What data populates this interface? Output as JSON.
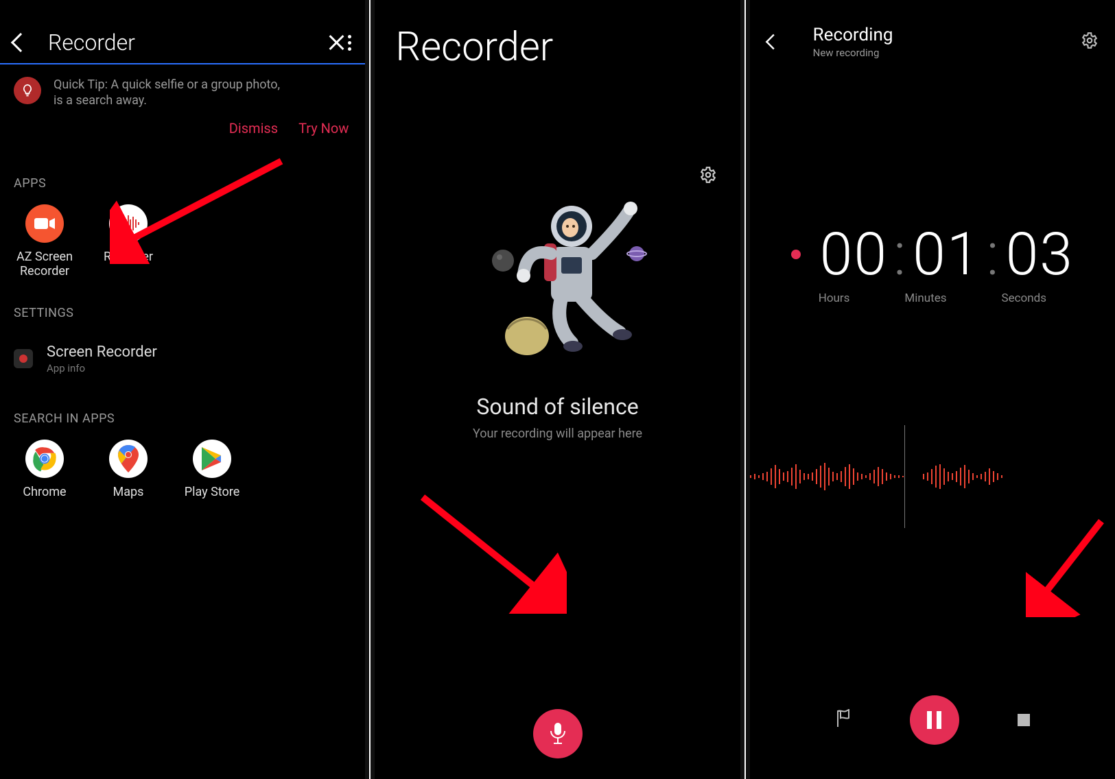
{
  "screen1": {
    "search_value": "Recorder",
    "tip_text": "Quick Tip: A quick selfie or a group photo, is a search away.",
    "tip_dismiss": "Dismiss",
    "tip_try": "Try Now",
    "section_apps": "APPS",
    "apps": [
      {
        "label": "AZ Screen Recorder"
      },
      {
        "label": "Recorder"
      }
    ],
    "section_settings": "SETTINGS",
    "settings_item": {
      "title": "Screen Recorder",
      "sub": "App info"
    },
    "section_search_in_apps": "SEARCH IN APPS",
    "search_apps": [
      {
        "label": "Chrome"
      },
      {
        "label": "Maps"
      },
      {
        "label": "Play Store"
      }
    ]
  },
  "screen2": {
    "title": "Recorder",
    "empty_title": "Sound of silence",
    "empty_sub": "Your recording will appear here"
  },
  "screen3": {
    "title": "Recording",
    "subtitle": "New recording",
    "time": {
      "hours": "00",
      "minutes": "01",
      "seconds": "03"
    },
    "labels": {
      "hours": "Hours",
      "minutes": "Minutes",
      "seconds": "Seconds"
    }
  }
}
